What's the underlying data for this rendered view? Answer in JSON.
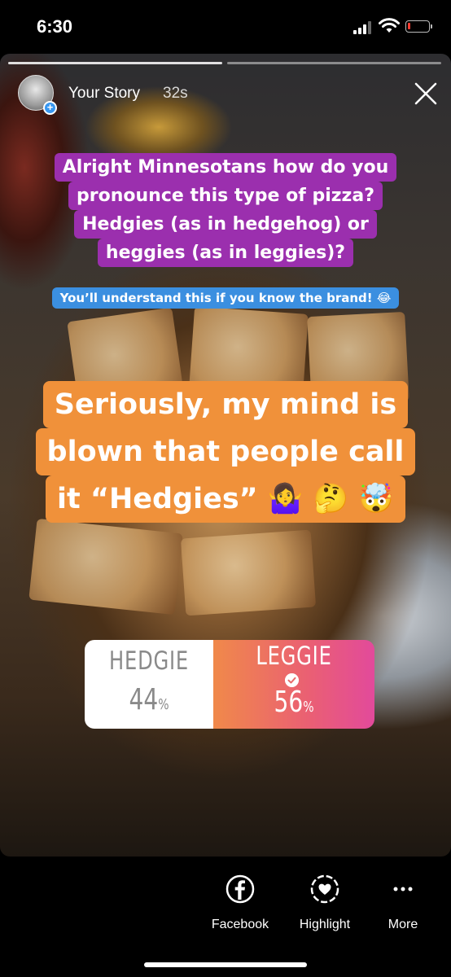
{
  "status_bar": {
    "time": "6:30",
    "battery_level": 0.12,
    "battery_color": "#ff3b30"
  },
  "story": {
    "user": "Your Story",
    "time_ago": "32s",
    "captions": {
      "question_lines": [
        "Alright Minnesotans how do you",
        "pronounce this type of pizza?",
        "Hedgies (as in hedgehog) or",
        "heggies (as in leggies)?"
      ],
      "hint": "You’ll understand this if you know the brand! 😂",
      "comment_lines": [
        "Seriously, my mind is",
        "blown that people call",
        "it “Hedgies” 🤷‍♀️ 🤔 🤯"
      ]
    },
    "poll": {
      "options": [
        {
          "label": "HEDGIE",
          "percent": "44",
          "selected": false
        },
        {
          "label": "LEGGIE",
          "percent": "56",
          "selected": true
        }
      ],
      "percent_sign": "%"
    },
    "colors": {
      "question_bg": "#9b2fae",
      "hint_bg": "#3b8fe0",
      "comment_bg": "#f0913a",
      "poll_accent": "#e24a9b"
    }
  },
  "actions": [
    {
      "label": "Facebook",
      "icon": "facebook-icon"
    },
    {
      "label": "Highlight",
      "icon": "highlight-heart-icon"
    },
    {
      "label": "More",
      "icon": "more-dots-icon"
    }
  ]
}
